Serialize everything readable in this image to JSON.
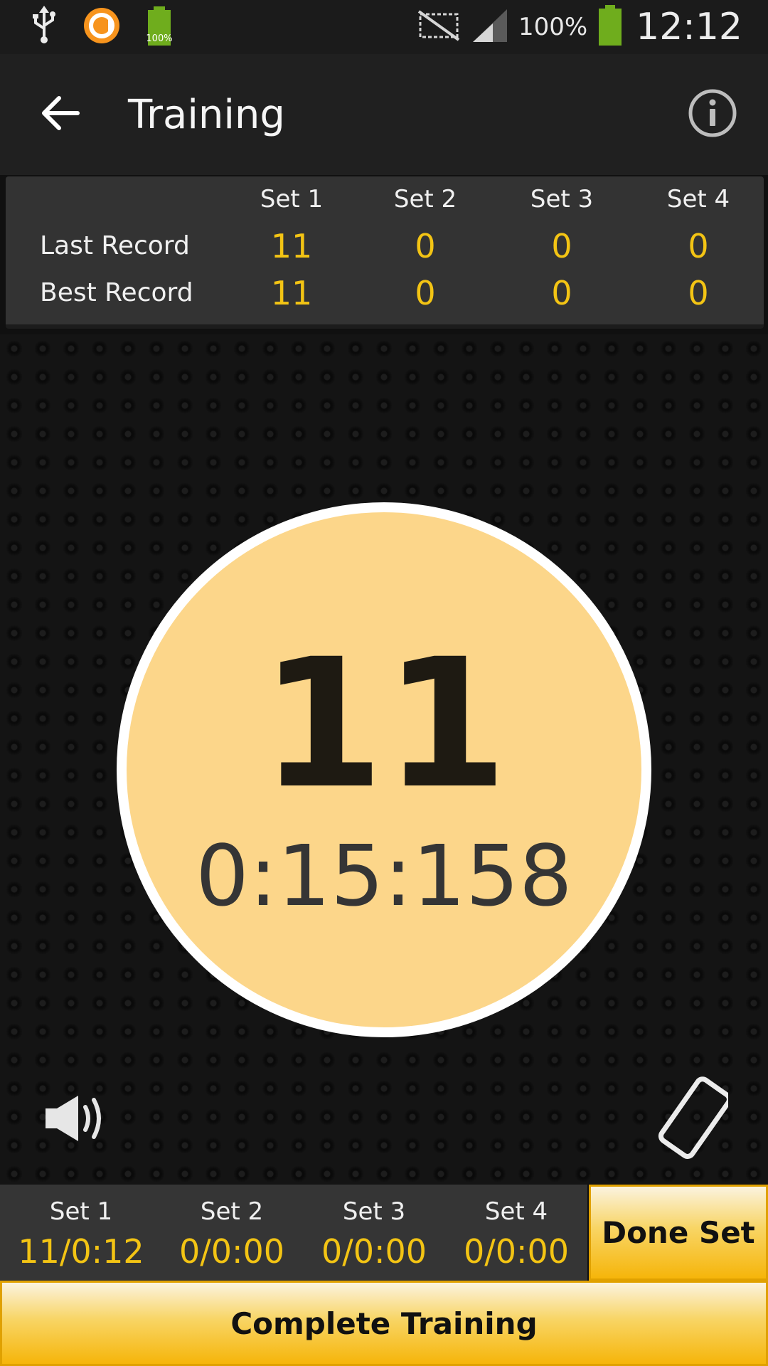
{
  "status_bar": {
    "notification_icons": [
      "usb-icon",
      "orange-app-icon",
      "battery-app-icon"
    ],
    "battery_app_label": "100%",
    "battery_percent": "100%",
    "clock": "12:12"
  },
  "action_bar": {
    "title": "Training",
    "back_icon": "arrow-left-icon",
    "info_icon": "info-icon"
  },
  "records": {
    "columns": [
      "Set 1",
      "Set 2",
      "Set 3",
      "Set 4"
    ],
    "rows": [
      {
        "label": "Last Record",
        "values": [
          "11",
          "0",
          "0",
          "0"
        ]
      },
      {
        "label": "Best Record",
        "values": [
          "11",
          "0",
          "0",
          "0"
        ]
      }
    ]
  },
  "timer": {
    "count": "11",
    "time": "0:15:158"
  },
  "controls": {
    "sound_icon": "speaker-icon",
    "phone_icon": "phone-rotate-icon"
  },
  "sets_summary": [
    {
      "name": "Set 1",
      "value": "11/0:12"
    },
    {
      "name": "Set 2",
      "value": "0/0:00"
    },
    {
      "name": "Set 3",
      "value": "0/0:00"
    },
    {
      "name": "Set 4",
      "value": "0/0:00"
    }
  ],
  "buttons": {
    "done_set": "Done Set",
    "complete_training": "Complete Training"
  },
  "colors": {
    "accent_yellow": "#f3c414",
    "circle_fill": "#fcd68a",
    "button_gradient_bottom": "#f6b50a",
    "battery_green": "#6fad1d"
  }
}
